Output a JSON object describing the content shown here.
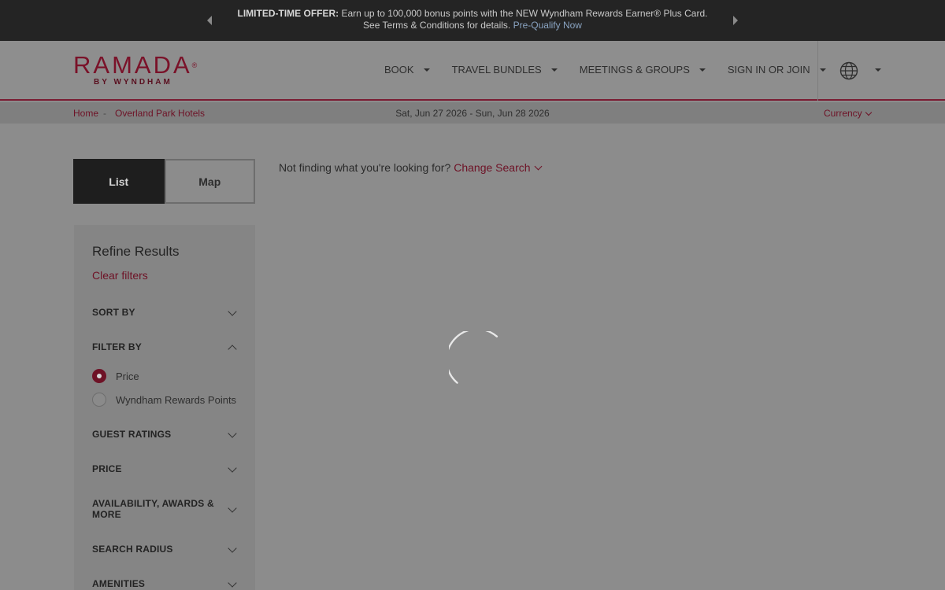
{
  "promo": {
    "bold": "LIMITED-TIME OFFER:",
    "text": " Earn up to 100,000 bonus points with the NEW Wyndham Rewards Earner® Plus Card. See Terms & Conditions for details. ",
    "link": "Pre-Qualify Now"
  },
  "logo": {
    "main": "RAMADA",
    "reg": "®",
    "sub": "BY WYNDHAM"
  },
  "nav": [
    {
      "label": "BOOK"
    },
    {
      "label": "TRAVEL BUNDLES"
    },
    {
      "label": "MEETINGS & GROUPS"
    },
    {
      "label": "SIGN IN OR JOIN"
    }
  ],
  "breadcrumb": {
    "home": "Home",
    "sep": "-",
    "current": "Overland Park Hotels"
  },
  "dates": "Sat, Jun 27 2026 - Sun, Jun 28 2026",
  "currency": "Currency",
  "view_toggle": {
    "list": "List",
    "map": "Map"
  },
  "not_finding": {
    "text": "Not finding what you're looking for?",
    "link": "Change Search"
  },
  "refine": {
    "title": "Refine Results",
    "clear": "Clear filters",
    "sections": [
      {
        "label": "SORT BY",
        "expanded": false
      },
      {
        "label": "FILTER BY",
        "expanded": true
      },
      {
        "label": "GUEST RATINGS",
        "expanded": false
      },
      {
        "label": "PRICE",
        "expanded": false
      },
      {
        "label": "AVAILABILITY, AWARDS & MORE",
        "expanded": false
      },
      {
        "label": "SEARCH RADIUS",
        "expanded": false
      },
      {
        "label": "AMENITIES",
        "expanded": false
      }
    ],
    "filter_options": [
      {
        "label": "Price",
        "selected": true
      },
      {
        "label": "Wyndham Rewards Points",
        "selected": false
      }
    ]
  },
  "colors": {
    "brand": "#7a1229",
    "promo_bg": "#242424",
    "overlay_bg": "#8c8c8c"
  },
  "icons": {
    "globe": "globe-icon",
    "spinner": "loading-spinner-icon"
  }
}
